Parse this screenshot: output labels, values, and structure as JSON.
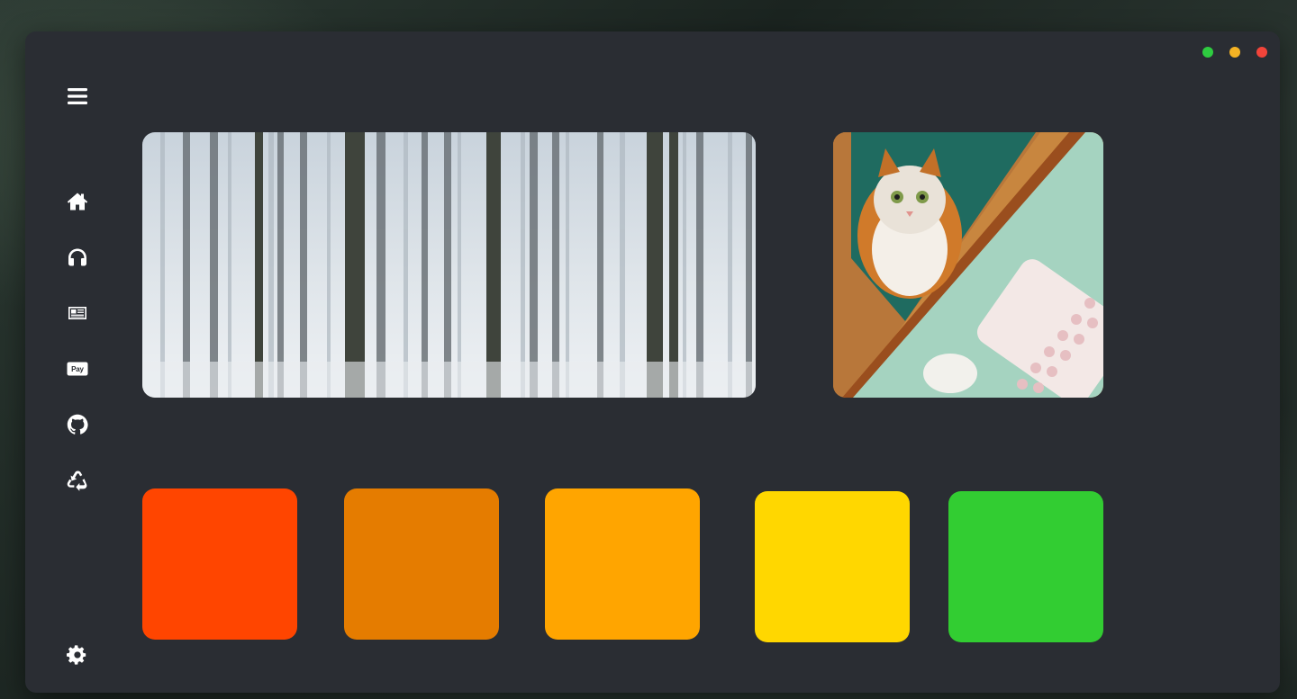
{
  "window": {
    "controls": [
      {
        "name": "maximize",
        "color": "#2ecc40"
      },
      {
        "name": "minimize",
        "color": "#f5b324"
      },
      {
        "name": "close",
        "color": "#f2443a"
      }
    ]
  },
  "sidebar": {
    "menu_icon": "menu-icon",
    "items": [
      {
        "icon": "home-icon"
      },
      {
        "icon": "headphones-icon"
      },
      {
        "icon": "newspaper-icon"
      },
      {
        "icon": "apple-pay-icon",
        "label": "Pay"
      },
      {
        "icon": "github-icon"
      },
      {
        "icon": "recycle-icon"
      }
    ],
    "settings_icon": "gear-icon"
  },
  "gallery": {
    "images": [
      {
        "subject": "snowy-forest-photo"
      },
      {
        "subject": "cat-on-desk-photo"
      }
    ]
  },
  "palette": {
    "swatches": [
      "#ff4500",
      "#e57c00",
      "#ffa500",
      "#ffd700",
      "#32cd32"
    ]
  }
}
